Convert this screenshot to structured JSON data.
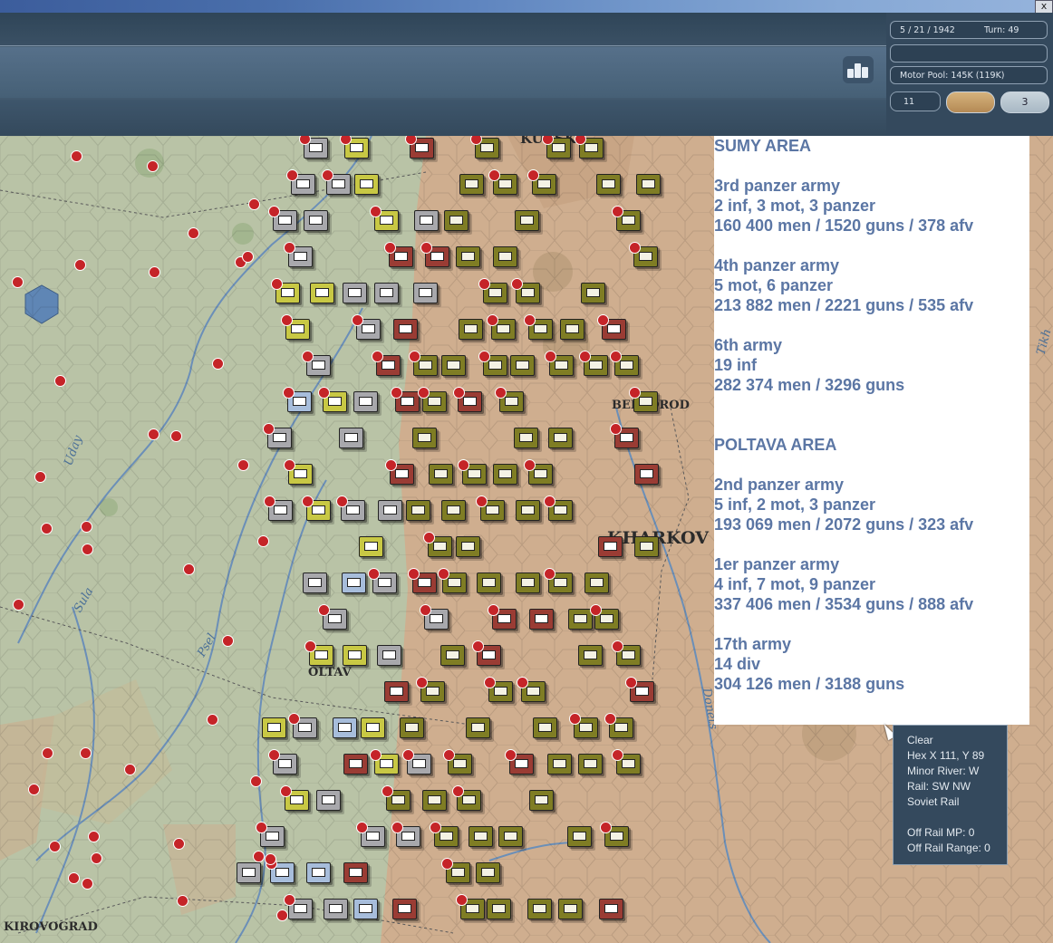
{
  "window": {
    "close_glyph": "x"
  },
  "info_panel": {
    "date": "5 / 21 / 1942",
    "turn": "Turn: 49",
    "motor_pool": "Motor Pool: 145K (119K)",
    "counter_value": "11",
    "weather_value": "3"
  },
  "map": {
    "cities": {
      "kursk": "KURSK",
      "belgorod": "BELGOROD",
      "kharkov": "KHARKOV",
      "poltava": "OLTAV",
      "kirovograd": "KIROVOGRAD"
    },
    "rivers": {
      "uday": "Uday",
      "sula": "Sula",
      "psel": "Psel",
      "donets": "Donets",
      "tikhaya": "Tikh"
    }
  },
  "report": {
    "sumy_area": {
      "heading": "SUMY AREA",
      "armies": [
        {
          "name": "3rd panzer army",
          "composition": "2 inf, 3 mot, 3 panzer",
          "strength": "160 400 men / 1520 guns / 378 afv"
        },
        {
          "name": "4th panzer army",
          "composition": "5 mot, 6 panzer",
          "strength": "213 882 men / 2221 guns / 535 afv"
        },
        {
          "name": "6th army",
          "composition": "19 inf",
          "strength": "282 374 men / 3296 guns"
        }
      ]
    },
    "poltava_area": {
      "heading": "POLTAVA AREA",
      "armies": [
        {
          "name": "2nd panzer army",
          "composition": "5 inf, 2 mot, 3 panzer",
          "strength": "193 069 men / 2072 guns / 323 afv"
        },
        {
          "name": "1er panzer army",
          "composition": "4 inf, 7 mot, 9 panzer",
          "strength": "337 406 men / 3534 guns / 888 afv"
        },
        {
          "name": "17th army",
          "composition": "14 div",
          "strength": "304 126 men / 3188 guns"
        }
      ]
    }
  },
  "hex_info": {
    "terrain": "Clear",
    "hex": "Hex X 111, Y 89",
    "minor_river": "Minor River: W",
    "rail": "Rail: SW NW",
    "rail_type": "Soviet Rail",
    "off_rail_mp": "Off Rail MP: 0",
    "off_rail_range": "Off Rail Range: 0"
  },
  "colors": {
    "report_text": "#5b76a4",
    "german_unit": "#7f7d24",
    "soviet_unit": "#9a3c34",
    "steppe": "#cfae8f",
    "plain": "#b9c3a6",
    "river": "#6b8fb8"
  }
}
